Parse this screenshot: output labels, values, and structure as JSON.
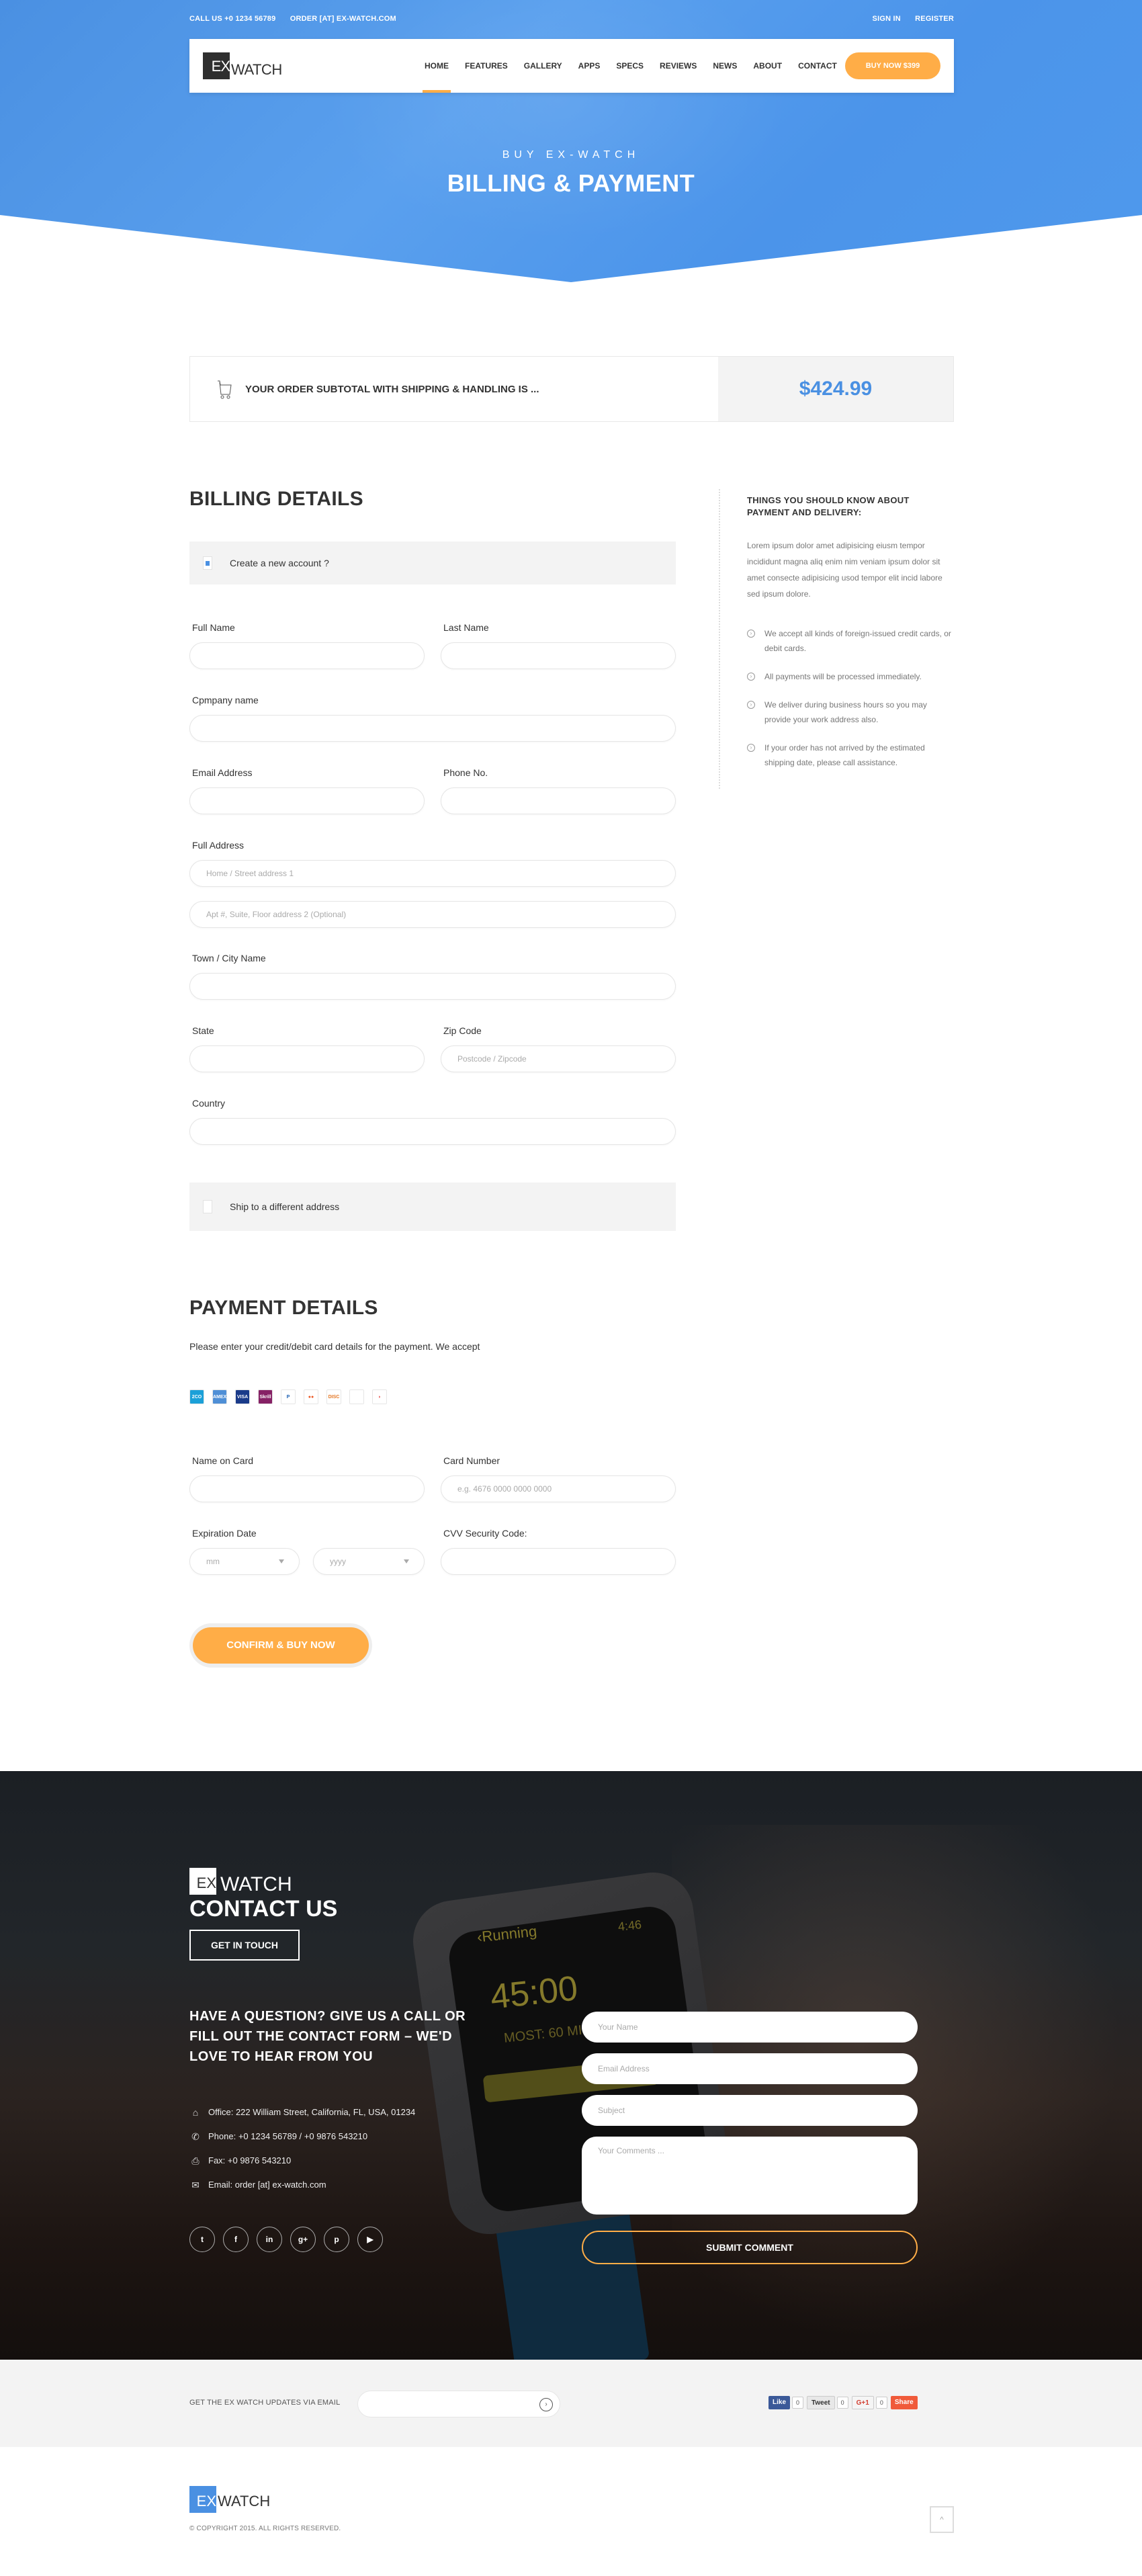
{
  "topbar": {
    "call": "CALL US  +0 1234 56789",
    "order": "ORDER [AT] EX-WATCH.COM",
    "sign_in": "SIGN IN",
    "register": "REGISTER"
  },
  "brand": {
    "ex": "EX",
    "watch": "WATCH"
  },
  "nav": {
    "items": [
      "HOME",
      "FEATURES",
      "GALLERY",
      "APPS",
      "SPECS",
      "REVIEWS",
      "NEWS",
      "ABOUT",
      "CONTACT"
    ],
    "active": "HOME",
    "buy_label": "BUY NOW $399"
  },
  "hero": {
    "subtitle": "BUY EX-WATCH",
    "title": "BILLING & PAYMENT"
  },
  "subtotal": {
    "icon": "cart-icon",
    "label": "YOUR ORDER SUBTOTAL WITH SHIPPING & HANDLING IS ...",
    "price": "$424.99"
  },
  "billing": {
    "title": "BILLING DETAILS",
    "create_account": {
      "label": "Create a new account ?",
      "checked": true
    },
    "fields": {
      "full_name": {
        "label": "Full Name",
        "placeholder": ""
      },
      "last_name": {
        "label": "Last Name",
        "placeholder": ""
      },
      "company": {
        "label": "Cpmpany name",
        "placeholder": ""
      },
      "email": {
        "label": "Email Address",
        "placeholder": ""
      },
      "phone": {
        "label": "Phone No.",
        "placeholder": ""
      },
      "address": {
        "label": "Full Address",
        "placeholder1": "Home / Street address 1",
        "placeholder2": "Apt #, Suite, Floor address 2 (Optional)"
      },
      "city": {
        "label": "Town / City Name",
        "placeholder": ""
      },
      "state": {
        "label": "State",
        "placeholder": ""
      },
      "zip": {
        "label": "Zip Code",
        "placeholder": "Postcode / Zipcode"
      },
      "country": {
        "label": "Country",
        "placeholder": ""
      }
    },
    "ship_different": {
      "label": "Ship to a different address",
      "checked": false
    }
  },
  "sidebar": {
    "title": "THINGS YOU SHOULD KNOW ABOUT PAYMENT AND DELIVERY:",
    "text": "Lorem ipsum dolor amet adipisicing eiusm tempor incididunt magna aliq enim nim veniam ipsum dolor sit amet consecte adipisicing usod tempor elit incid labore sed ipsum dolore.",
    "items": [
      "We accept all kinds of foreign-issued credit cards, or debit cards.",
      "All payments will be processed immediately.",
      "We deliver during business hours so you may provide your work address also.",
      "If your order has not arrived by the estimated shipping date, please call assistance."
    ]
  },
  "payment": {
    "title": "PAYMENT DETAILS",
    "description": "Please enter your credit/debit card details for the payment. We accept",
    "cards": [
      {
        "name": "2checkout",
        "label": "2CO",
        "color": "#1ba0d8",
        "fg": "#ffffff"
      },
      {
        "name": "american-express",
        "label": "AMEX",
        "color": "#4f8fd6",
        "fg": "#ffffff"
      },
      {
        "name": "visa",
        "label": "VISA",
        "color": "#1a3b8a",
        "fg": "#ffffff"
      },
      {
        "name": "skrill",
        "label": "Skrill",
        "color": "#862165",
        "fg": "#ffffff"
      },
      {
        "name": "paypal",
        "label": "P",
        "color": "#ffffff",
        "fg": "#1b5fb1"
      },
      {
        "name": "mastercard",
        "label": "●●",
        "color": "#ffffff",
        "fg": "#eb5a26"
      },
      {
        "name": "discover",
        "label": "DISC",
        "color": "#ffffff",
        "fg": "#e47623"
      },
      {
        "name": "apple-pay",
        "label": "",
        "color": "#ffffff",
        "fg": "#333333"
      },
      {
        "name": "google-wallet",
        "label": "◗",
        "color": "#ffffff",
        "fg": "#e53935"
      }
    ],
    "fields": {
      "name_on_card": {
        "label": "Name on Card",
        "placeholder": ""
      },
      "card_number": {
        "label": "Card Number",
        "placeholder": "e.g. 4676 0000 0000 0000"
      },
      "expiration": {
        "label": "Expiration Date",
        "month": "mm",
        "year": "yyyy"
      },
      "cvv": {
        "label": "CVV Security Code:",
        "placeholder": ""
      }
    },
    "confirm_label": "CONFIRM & BUY NOW"
  },
  "contact": {
    "logo_ex": "EX",
    "logo_watch": "WATCH",
    "title": "CONTACT US",
    "button": "GET IN TOUCH",
    "question": "HAVE A QUESTION? GIVE US A CALL OR FILL OUT THE CONTACT FORM – WE'D LOVE TO HEAR FROM YOU",
    "info": [
      {
        "icon": "home-icon",
        "glyph": "⌂",
        "text": "Office: 222 William Street, California, FL, USA, 01234"
      },
      {
        "icon": "phone-icon",
        "glyph": "✆",
        "text": "Phone: +0 1234 56789  /  +0 9876 543210"
      },
      {
        "icon": "fax-icon",
        "glyph": "⎙",
        "text": "Fax: +0 9876 543210"
      },
      {
        "icon": "envelope-icon",
        "glyph": "✉",
        "text": "Email: order [at] ex-watch.com"
      }
    ],
    "socials": [
      {
        "name": "twitter",
        "glyph": "t"
      },
      {
        "name": "facebook",
        "glyph": "f"
      },
      {
        "name": "linkedin",
        "glyph": "in"
      },
      {
        "name": "google-plus",
        "glyph": "g+"
      },
      {
        "name": "pinterest",
        "glyph": "p"
      },
      {
        "name": "youtube",
        "glyph": "▶"
      }
    ],
    "watch_screen": {
      "app": "‹Running",
      "time": "4:46",
      "timer": "45:00",
      "most": "MOST: 60 MIN"
    },
    "form": {
      "name_placeholder": "Your Name",
      "email_placeholder": "Email Address",
      "subject_placeholder": "Subject",
      "comments_placeholder": "Your Comments ...",
      "submit": "SUBMIT COMMENT"
    }
  },
  "newsletter": {
    "label": "GET THE EX WATCH UPDATES VIA EMAIL",
    "placeholder": ""
  },
  "share": {
    "like": "Like",
    "like_count": "0",
    "tweet": "Tweet",
    "tweet_count": "0",
    "gplus": "G+1",
    "gplus_count": "0",
    "share": "Share"
  },
  "footer": {
    "logo_ex": "EX",
    "logo_watch": "WATCH",
    "copyright": "© COPYRIGHT 2015. ALL RIGHTS RESERVED.",
    "to_top": "^"
  },
  "colors": {
    "primary": "#4a90e2",
    "accent": "#ffad47",
    "dark": "#2f2f2f"
  }
}
